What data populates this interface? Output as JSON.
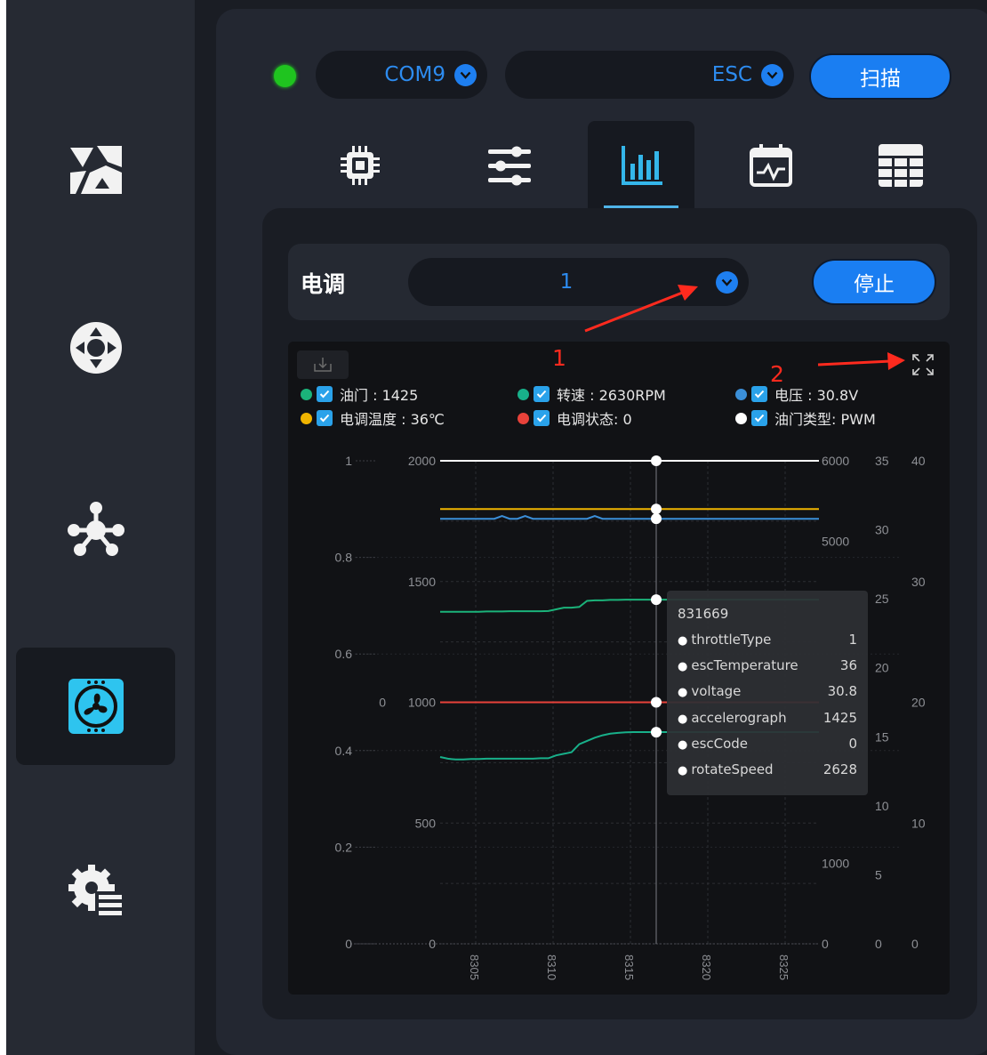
{
  "sidebar": {
    "items": [
      {
        "icon": "map-triangle-icon",
        "active": false
      },
      {
        "icon": "joystick-icon",
        "active": false
      },
      {
        "icon": "drone-hub-icon",
        "active": false
      },
      {
        "icon": "fan-esc-icon",
        "active": true
      },
      {
        "icon": "gear-list-icon",
        "active": false
      }
    ]
  },
  "topbar": {
    "status_color": "#1fc41f",
    "port_value": "COM9",
    "device_value": "ESC",
    "scan_label": "扫描"
  },
  "tabs": [
    {
      "icon": "chip-icon",
      "active": false
    },
    {
      "icon": "sliders-icon",
      "active": false
    },
    {
      "icon": "bar-chart-icon",
      "active": true
    },
    {
      "icon": "calendar-wave-icon",
      "active": false
    },
    {
      "icon": "table-icon",
      "active": false
    }
  ],
  "esc_panel": {
    "label": "电调",
    "selected_esc": "1",
    "stop_label": "停止"
  },
  "annotations": {
    "marker_1": "1",
    "marker_2": "2"
  },
  "legend": [
    {
      "color": "#1bb37a",
      "text": "油门 : 1425"
    },
    {
      "color": "#18b08a",
      "text": "转速 : 2630RPM"
    },
    {
      "color": "#3b8fd8",
      "text": "电压 : 30.8V"
    },
    {
      "color": "#f0b400",
      "text": "电调温度 : 36℃"
    },
    {
      "color": "#e8423a",
      "text": "电调状态: 0"
    },
    {
      "color": "#ffffff",
      "text": "油门类型: PWM"
    }
  ],
  "tooltip": {
    "title": "831669",
    "rows": [
      {
        "k": "throttleType",
        "v": "1"
      },
      {
        "k": "escTemperature",
        "v": "36"
      },
      {
        "k": "voltage",
        "v": "30.8"
      },
      {
        "k": "accelerograph",
        "v": "1425"
      },
      {
        "k": "escCode",
        "v": "0"
      },
      {
        "k": "rotateSpeed",
        "v": "2628"
      }
    ]
  },
  "chart_data": {
    "type": "line",
    "x_ticks": [
      "8305",
      "8310",
      "8315",
      "8320",
      "8325"
    ],
    "axes": {
      "axis1": {
        "ticks": [
          "1",
          "0.8",
          "0.6",
          "0.4",
          "0.2",
          "0"
        ],
        "range": [
          0,
          1
        ]
      },
      "axis2": {
        "ticks": [
          "0"
        ]
      },
      "axis3": {
        "ticks": [
          "2000",
          "1500",
          "1000",
          "500",
          "0"
        ],
        "range": [
          0,
          2000
        ]
      },
      "axis4": {
        "ticks": [
          "6000",
          "5000",
          "1000",
          "0"
        ],
        "range": [
          0,
          6000
        ]
      },
      "axis5": {
        "ticks": [
          "35",
          "30",
          "25",
          "20",
          "15",
          "10",
          "5",
          "0"
        ],
        "range": [
          0,
          35
        ]
      },
      "axis6": {
        "ticks": [
          "40",
          "30",
          "20",
          "10",
          "0"
        ],
        "range": [
          0,
          40
        ]
      }
    },
    "series": [
      {
        "color": "#ffffff",
        "values": [
          1,
          1,
          1,
          1,
          1,
          1,
          1,
          1,
          1,
          1,
          1,
          1,
          1,
          1,
          1,
          1,
          1,
          1,
          1,
          1,
          1,
          1,
          1,
          1,
          1,
          1,
          1,
          1,
          1,
          1,
          1,
          1,
          1,
          1,
          1,
          1,
          1,
          1,
          1,
          1,
          1,
          1,
          1,
          1,
          1,
          1,
          1,
          1,
          1,
          1
        ],
        "highlight": 1
      },
      {
        "color": "#f0b400",
        "values": [
          36,
          36,
          36,
          36,
          36,
          36,
          36,
          36,
          36,
          36,
          36,
          36,
          36,
          36,
          36,
          36,
          36,
          36,
          36,
          36,
          36,
          36,
          36,
          36,
          36,
          36,
          36,
          36,
          36,
          36,
          36,
          36,
          36,
          36,
          36,
          36,
          36,
          36,
          36,
          36,
          36,
          36,
          36,
          36,
          36,
          36,
          36,
          36,
          36,
          36
        ],
        "highlight": 36
      },
      {
        "color": "#3b8fd8",
        "values": [
          30.8,
          30.8,
          30.8,
          30.8,
          30.8,
          30.8,
          30.8,
          30.8,
          31.0,
          30.8,
          30.8,
          31.0,
          30.8,
          30.8,
          30.8,
          30.8,
          30.8,
          30.8,
          30.8,
          30.8,
          31.0,
          30.8,
          30.8,
          30.8,
          30.8,
          30.8,
          30.8,
          30.8,
          30.8,
          30.8,
          30.8,
          30.8,
          30.8,
          30.8,
          30.8,
          30.8,
          30.8,
          30.8,
          30.8,
          30.8,
          30.8,
          30.8,
          30.8,
          30.8,
          30.8,
          30.8,
          30.8,
          30.8,
          30.8,
          30.8
        ],
        "highlight": 30.8
      },
      {
        "color": "#1bb37a",
        "values": [
          1375,
          1375,
          1375,
          1375,
          1375,
          1375,
          1376,
          1376,
          1376,
          1377,
          1377,
          1377,
          1377,
          1377,
          1378,
          1385,
          1392,
          1392,
          1395,
          1420,
          1422,
          1422,
          1424,
          1424,
          1425,
          1425,
          1425,
          1425,
          1425,
          1425,
          1425,
          1425,
          1425,
          1425,
          1425,
          1425,
          1425,
          1425,
          1425,
          1425,
          1425,
          1425,
          1425,
          1425,
          1425,
          1425,
          1425,
          1425,
          1425,
          1425
        ],
        "highlight": 1425
      },
      {
        "color": "#e8423a",
        "values": [
          0,
          0,
          0,
          0,
          0,
          0,
          0,
          0,
          0,
          0,
          0,
          0,
          0,
          0,
          0,
          0,
          0,
          0,
          0,
          0,
          0,
          0,
          0,
          0,
          0,
          0,
          0,
          0,
          0,
          0,
          0,
          0,
          0,
          0,
          0,
          0,
          0,
          0,
          0,
          0,
          0,
          0,
          0,
          0,
          0,
          0,
          0,
          0,
          0,
          0
        ],
        "highlight": 0
      },
      {
        "color": "#18b08a",
        "values": [
          2320,
          2300,
          2290,
          2290,
          2295,
          2295,
          2300,
          2300,
          2300,
          2300,
          2300,
          2300,
          2300,
          2305,
          2305,
          2340,
          2360,
          2380,
          2480,
          2520,
          2560,
          2590,
          2610,
          2620,
          2628,
          2630,
          2630,
          2630,
          2630,
          2630,
          2630,
          2630,
          2630,
          2630,
          2630,
          2630,
          2630,
          2630,
          2630,
          2630,
          2630,
          2630,
          2630,
          2630,
          2630,
          2630,
          2630,
          2630,
          2630,
          2630
        ],
        "highlight": 2628
      }
    ]
  }
}
